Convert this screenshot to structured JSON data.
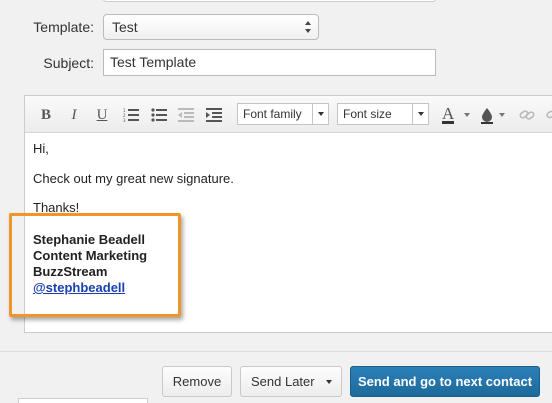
{
  "form": {
    "template_label": "Template:",
    "template_value": "Test",
    "subject_label": "Subject:",
    "subject_value": "Test Template"
  },
  "toolbar": {
    "bold": "B",
    "italic": "I",
    "underline": "U",
    "font_family": "Font family",
    "font_size": "Font size",
    "text_color": "A"
  },
  "editor": {
    "lines": [
      "Hi,",
      "Check out my great new signature.",
      "Thanks!"
    ],
    "signature": {
      "name": "Stephanie Beadell",
      "title": "Content Marketing",
      "company": "BuzzStream",
      "handle": "@stephbeadell "
    }
  },
  "actions": {
    "remove": "Remove",
    "send_later": "Send Later",
    "send_next": "Send and go to next contact"
  },
  "colors": {
    "primary_button": "#2272a8",
    "highlight_border": "#f0952a",
    "link": "#1a3fb0"
  }
}
